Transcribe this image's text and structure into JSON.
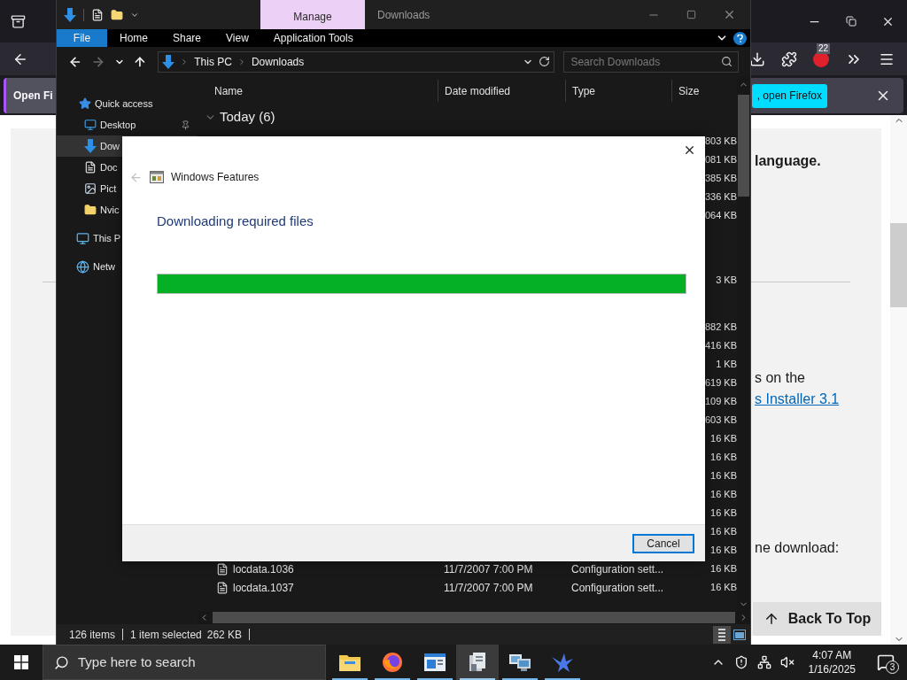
{
  "browser": {
    "toolbar_badge": "22",
    "notification": {
      "buttons": [
        {
          "kind": "secondary",
          "label": "Open Fi"
        },
        {
          "kind": "primary",
          "label": ", open Firefox"
        }
      ]
    },
    "page": {
      "items": [
        {
          "kind": "heading",
          "text": "language."
        },
        {
          "kind": "text",
          "text": "s on the"
        },
        {
          "kind": "link",
          "text": "s Installer 3.1"
        },
        {
          "kind": "text",
          "text": "ne download:"
        }
      ],
      "back_to_top": "Back To Top"
    }
  },
  "explorer": {
    "title": "Downloads",
    "context_tab": "Manage",
    "ribbon_tabs": [
      {
        "label": "File",
        "selected": true
      },
      {
        "label": "Home",
        "selected": false
      },
      {
        "label": "Share",
        "selected": false
      },
      {
        "label": "View",
        "selected": false
      },
      {
        "label": "Application Tools",
        "selected": false
      }
    ],
    "nav_buttons": [
      {
        "kind": "back",
        "disabled": false
      },
      {
        "kind": "forward",
        "disabled": true
      },
      {
        "kind": "recent",
        "disabled": false
      },
      {
        "kind": "up",
        "disabled": false
      }
    ],
    "breadcrumb": [
      "This PC",
      "Downloads"
    ],
    "search": {
      "placeholder": "Search Downloads"
    },
    "nav": [
      {
        "kind": "star",
        "label": "Quick access",
        "selected": false,
        "children": [
          {
            "kind": "desktop",
            "label": "Desktop",
            "selected": false,
            "pinned": true
          },
          {
            "kind": "download",
            "label": "Dow",
            "selected": true
          },
          {
            "kind": "document",
            "label": "Doc",
            "selected": false
          },
          {
            "kind": "pictures",
            "label": "Pict",
            "selected": false
          },
          {
            "kind": "folder",
            "label": "Nvic",
            "selected": false
          }
        ]
      },
      {
        "kind": "pc",
        "label": "This P",
        "selected": false
      },
      {
        "kind": "network",
        "label": "Netw",
        "selected": false
      }
    ],
    "columns": [
      "Name",
      "Date modified",
      "Type",
      "Size"
    ],
    "groups": [
      {
        "header": "Today (6)",
        "rows": [
          {
            "size": "803 KB"
          },
          {
            "size": "081 KB"
          },
          {
            "size": "385 KB"
          },
          {
            "size": "336 KB"
          },
          {
            "size": "064 KB"
          }
        ]
      },
      {
        "rows": [
          {
            "size": "3 KB"
          }
        ]
      },
      {
        "rows": [
          {
            "size": "882 KB"
          },
          {
            "size": "416 KB"
          },
          {
            "size": "1 KB"
          },
          {
            "size": "619 KB"
          },
          {
            "size": "109 KB"
          },
          {
            "size": "603 KB"
          },
          {
            "size": "16 KB"
          },
          {
            "size": "16 KB"
          },
          {
            "size": "16 KB"
          },
          {
            "size": "16 KB"
          },
          {
            "size": "16 KB"
          },
          {
            "size": "16 KB"
          },
          {
            "size": "16 KB"
          },
          {
            "name": "locdata.1036",
            "date": "11/7/2007 7:00 PM",
            "type": "Configuration sett...",
            "size": "16 KB"
          },
          {
            "name": "locdata.1037",
            "date": "11/7/2007 7:00 PM",
            "type": "Configuration sett...",
            "size": "16 KB"
          }
        ]
      }
    ],
    "status": {
      "items": "126 items",
      "selection": "1 item selected",
      "selection_size": "262 KB"
    },
    "views": [
      {
        "kind": "details",
        "selected": true
      },
      {
        "kind": "tiles",
        "selected": false
      }
    ]
  },
  "dialog": {
    "title": "Windows Features",
    "back_disabled": true,
    "heading": "Downloading required files",
    "progress": {
      "level": 1
    },
    "cancel": "Cancel"
  },
  "taskbar": {
    "search_placeholder": "Type here to search",
    "apps": [
      {
        "kind": "explorer",
        "active": false
      },
      {
        "kind": "firefox",
        "active": false
      },
      {
        "kind": "window",
        "active": false
      },
      {
        "kind": "installer",
        "active": true
      },
      {
        "kind": "network",
        "active": false
      },
      {
        "kind": "bird",
        "active": false
      }
    ],
    "time": "4:07 AM",
    "date": "1/16/2025",
    "notification_count": "3"
  }
}
